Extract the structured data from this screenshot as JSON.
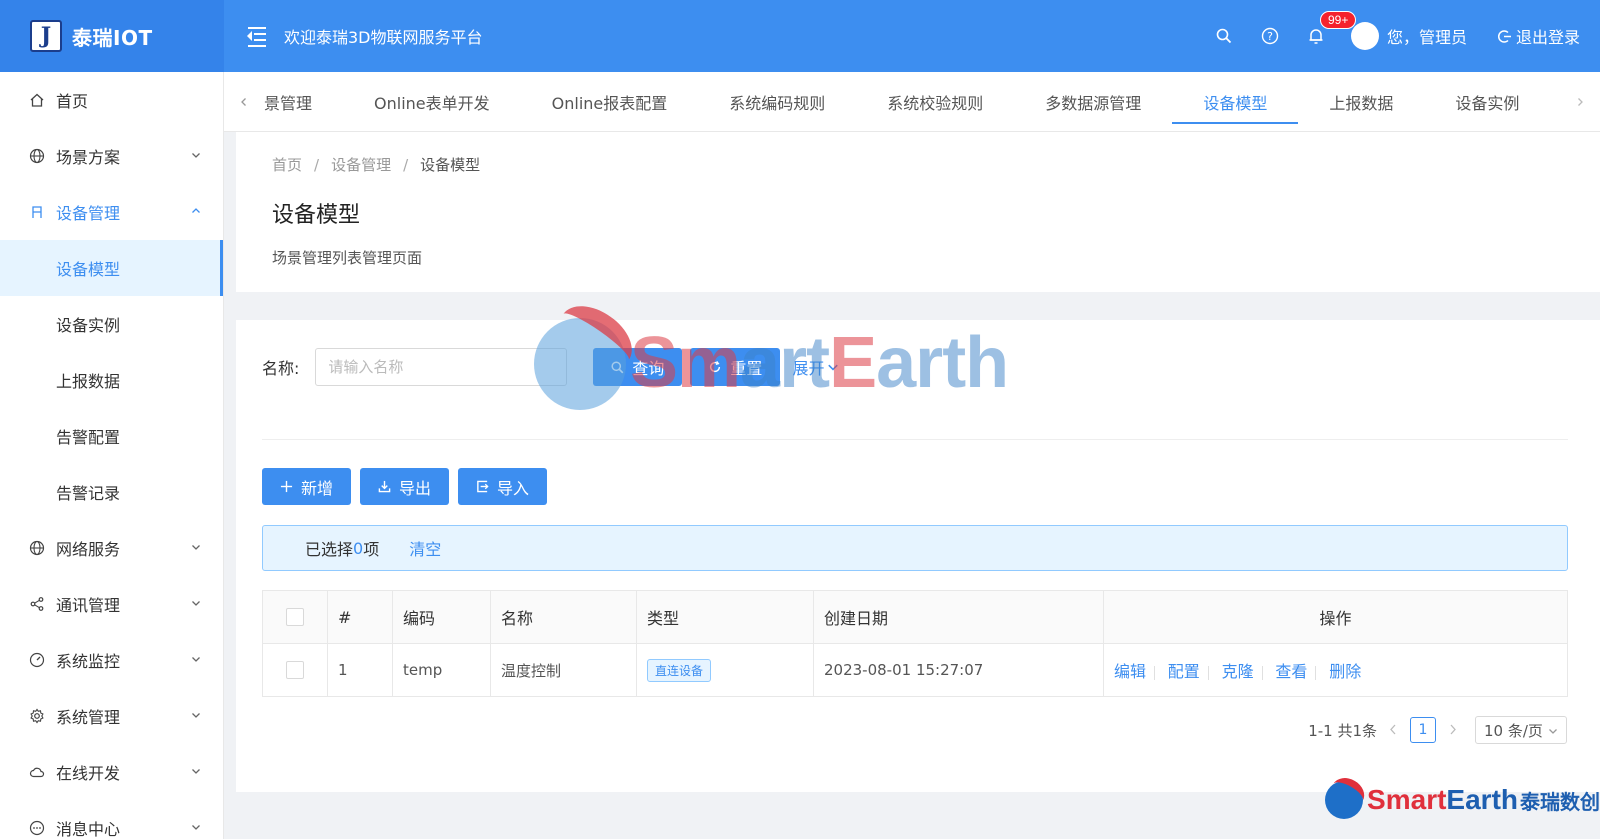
{
  "header": {
    "logo_letter": "J",
    "logo_text": "泰瑞IOT",
    "welcome": "欢迎泰瑞3D物联网服务平台",
    "badge": "99+",
    "username": "您，管理员",
    "logout": "退出登录"
  },
  "sidebar": {
    "home": "首页",
    "scene": "场景方案",
    "device_mgmt": "设备管理",
    "subs": [
      "设备模型",
      "设备实例",
      "上报数据",
      "告警配置",
      "告警记录"
    ],
    "network": "网络服务",
    "comm": "通讯管理",
    "monitor": "系统监控",
    "sysmgmt": "系统管理",
    "online_dev": "在线开发",
    "message": "消息中心"
  },
  "tabs": [
    "景管理",
    "Online表单开发",
    "Online报表配置",
    "系统编码规则",
    "系统校验规则",
    "多数据源管理",
    "设备模型",
    "上报数据",
    "设备实例"
  ],
  "page": {
    "breadcrumb": [
      "首页",
      "设备管理",
      "设备模型"
    ],
    "breadcrumb_sep": "/",
    "title": "设备模型",
    "description": "场景管理列表管理页面"
  },
  "search": {
    "label": "名称:",
    "placeholder": "请输入名称",
    "query": "查询",
    "reset": "重置",
    "expand": "展开"
  },
  "actions": {
    "add": "新增",
    "export": "导出",
    "import": "导入"
  },
  "selection": {
    "prefix": "已选择",
    "count": "0",
    "suffix": "项",
    "clear": "清空"
  },
  "table": {
    "headers": [
      "#",
      "编码",
      "名称",
      "类型",
      "创建日期",
      "操作"
    ],
    "rows": [
      {
        "index": "1",
        "code": "temp",
        "name": "温度控制",
        "type": "直连设备",
        "date": "2023-08-01 15:27:07",
        "ops": [
          "编辑",
          "配置",
          "克隆",
          "查看",
          "删除"
        ]
      }
    ]
  },
  "pager": {
    "summary": "1-1 共1条",
    "current": "1",
    "page_size": "10 条/页"
  },
  "watermark": {
    "center": "SmartEarth",
    "corner_brand_r": "Smart",
    "corner_brand_b": "Earth",
    "corner_cn": "泰瑞数创"
  },
  "colors": {
    "primary": "#3d8ef0",
    "header_bg": "#3d8ef0",
    "badge": "#f5222d"
  }
}
